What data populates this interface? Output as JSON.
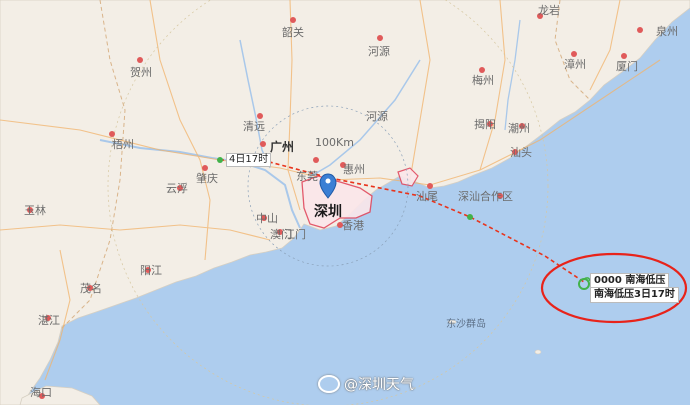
{
  "map": {
    "places": [
      {
        "id": "longyan",
        "name": "龙岩"
      },
      {
        "id": "shaoguan",
        "name": "韶关"
      },
      {
        "id": "heyuan",
        "name": "河源"
      },
      {
        "id": "meizhou",
        "name": "梅州"
      },
      {
        "id": "zhangzhou",
        "name": "漳州"
      },
      {
        "id": "quanzhou",
        "name": "泉州"
      },
      {
        "id": "xiamen",
        "name": "厦门"
      },
      {
        "id": "hezhou",
        "name": "贺州"
      },
      {
        "id": "wuzhou",
        "name": "梧州"
      },
      {
        "id": "qingyuan",
        "name": "清远"
      },
      {
        "id": "guangzhou",
        "name": "广州"
      },
      {
        "id": "dongguan",
        "name": "东莞"
      },
      {
        "id": "huizhou",
        "name": "惠州"
      },
      {
        "id": "zhaoqing",
        "name": "肇庆"
      },
      {
        "id": "yunfu",
        "name": "云浮"
      },
      {
        "id": "jieyang",
        "name": "揭阳"
      },
      {
        "id": "chaozhou",
        "name": "潮州"
      },
      {
        "id": "shantou",
        "name": "汕头"
      },
      {
        "id": "yulin",
        "name": "玉林"
      },
      {
        "id": "zhongshan",
        "name": "中山"
      },
      {
        "id": "aomen",
        "name": "澳门"
      },
      {
        "id": "jiangmen",
        "name": "江门"
      },
      {
        "id": "xianggang",
        "name": "香港"
      },
      {
        "id": "shanwei",
        "name": "汕尾"
      },
      {
        "id": "shenshan",
        "name": "深汕合作区"
      },
      {
        "id": "yangjiang",
        "name": "阳江"
      },
      {
        "id": "maoming",
        "name": "茂名"
      },
      {
        "id": "zhanjiang",
        "name": "湛江"
      },
      {
        "id": "haikou",
        "name": "海口"
      },
      {
        "id": "heyuan2",
        "name": "河源"
      },
      {
        "id": "dongsha",
        "name": "东沙群岛"
      }
    ],
    "city_highlight": "深圳",
    "range_label": "100Km",
    "forecast_label": "4日17时",
    "storm": {
      "line1": "0000 南海低压",
      "line2": "南海低压3日17时"
    },
    "colors": {
      "sea": "#aecdee",
      "land": "#f3eee6",
      "track": "#e8341c",
      "circle": "#e8231a",
      "storm_icon": "#42b24a",
      "marker": "#3b7fd4"
    }
  },
  "watermark": {
    "text": "@深圳天气"
  }
}
